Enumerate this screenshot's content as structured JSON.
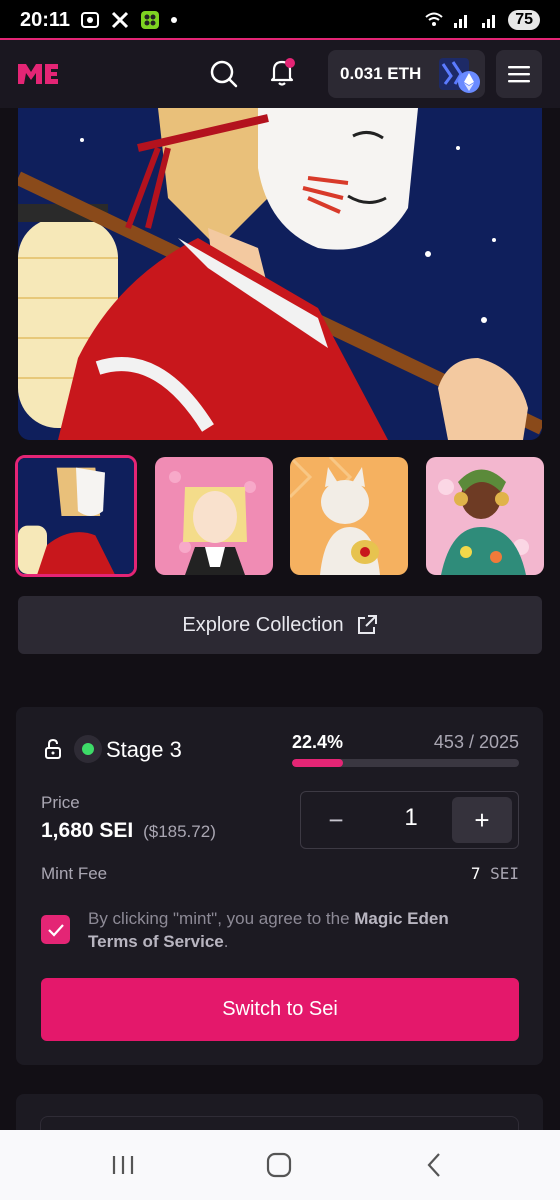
{
  "status_bar": {
    "time": "20:11",
    "battery": "75"
  },
  "header": {
    "wallet_balance": "0.031 ETH"
  },
  "explore_button": {
    "label": "Explore Collection"
  },
  "mint": {
    "stage": "Stage 3",
    "percent_minted": "22.4%",
    "minted_fraction": 0.224,
    "count": "453 / 2025",
    "price_label": "Price",
    "price_value": "1,680 SEI",
    "price_usd": "($185.72)",
    "quantity": "1",
    "minus_label": "−",
    "plus_label": "+",
    "fee_label": "Mint Fee",
    "fee_amount": "7",
    "fee_currency": "SEI",
    "terms_prefix": "By clicking \"mint\", you agree to the ",
    "terms_brand": "Magic Eden",
    "terms_link": "Terms of Service",
    "terms_suffix": ".",
    "terms_checked": true,
    "action_button": "Switch to Sei"
  },
  "colors": {
    "accent": "#e42575",
    "background": "#120f15",
    "card": "#1c1a22",
    "live_dot": "#3ddc68"
  },
  "icons": [
    "magic-eden-logo",
    "search-icon",
    "bell-icon",
    "ethereum-icon",
    "hamburger-menu-icon",
    "external-link-icon",
    "unlock-icon",
    "check-icon"
  ]
}
